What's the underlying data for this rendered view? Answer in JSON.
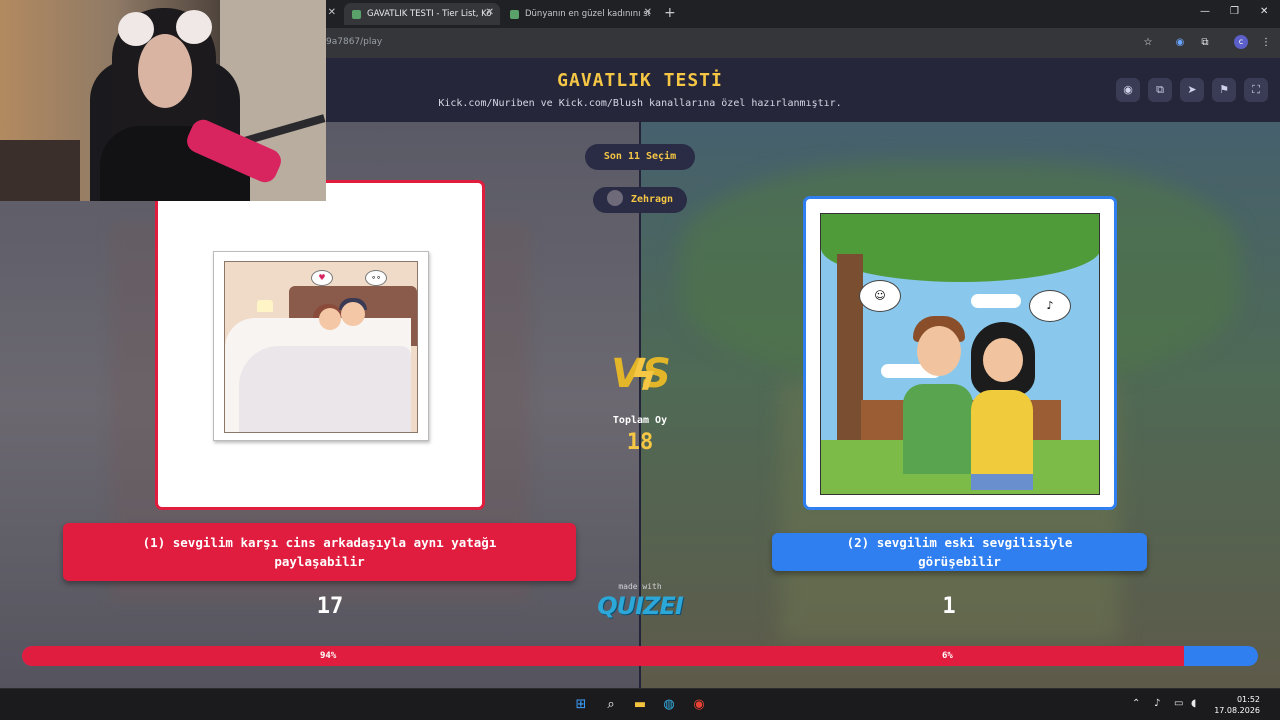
{
  "browser": {
    "tabs": [
      {
        "label": "",
        "active": false
      },
      {
        "label": "GAVATLIK TESTİ - Tier List, Kör",
        "active": true
      },
      {
        "label": "Dünyanın en güzel kadınını seç",
        "active": false
      }
    ],
    "url": "9a7867/play",
    "profile_initial": "c"
  },
  "header": {
    "title": "GAVATLIK TESTİ",
    "subtitle": "Kick.com/Nuriben ve Kick.com/Blush kanallarına özel hazırlanmıştır.",
    "buttons": [
      "eye-icon",
      "copy-icon",
      "send-icon",
      "flag-icon",
      "fullscreen-icon"
    ]
  },
  "round": {
    "stage": "Son 11 Seçim",
    "player": "Zehragn"
  },
  "left_option": {
    "label": "(1) sevgilim karşı cins arkadaşıyla aynı yatağı paylaşabilir",
    "votes": "17",
    "percent": "94%",
    "fraction": 0.94,
    "color": "#e11d3f"
  },
  "right_option": {
    "label": "(2) sevgilim eski sevgilisiyle görüşebilir",
    "votes": "1",
    "percent": "6%",
    "fraction": 0.06,
    "color": "#2f7ff0"
  },
  "center": {
    "vs": "VS",
    "total_label": "Toplam Oy",
    "total_value": "18",
    "made_with": "made with",
    "logo": "QUIZEI"
  },
  "taskbar": {
    "time": "01:52",
    "date": "17.08.2026"
  }
}
